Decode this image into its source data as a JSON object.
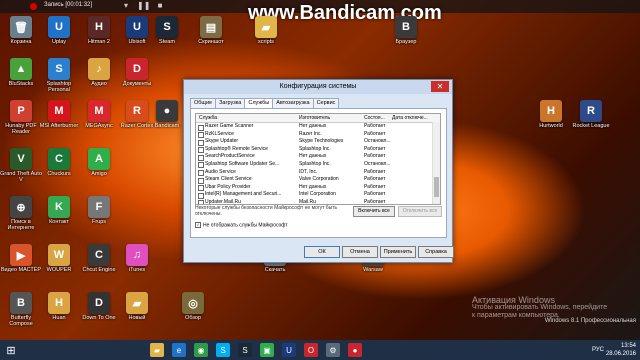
{
  "recorder": {
    "status": "Запись [00:01:32]"
  },
  "watermark": {
    "text": "www.Bandicam.com"
  },
  "desktop_icons": [
    {
      "label": "Корзина",
      "color": "#6a7f8e",
      "glyph": "🗑"
    },
    {
      "label": "Uplay",
      "color": "#1e73c9",
      "glyph": "U"
    },
    {
      "label": "Hitman 2",
      "color": "#5b2828",
      "glyph": "H"
    },
    {
      "label": "Ubisoft",
      "color": "#1a3a7a",
      "glyph": "U"
    },
    {
      "label": "Steam",
      "color": "#1b2838",
      "glyph": "S"
    },
    {
      "label": "Скриншот",
      "color": "#7d6b45",
      "glyph": "▤"
    },
    {
      "label": "scripts",
      "color": "#e0b64b",
      "glyph": "▰"
    },
    {
      "label": "Браузер",
      "color": "#3a3a3a",
      "glyph": "B"
    },
    {
      "label": "BluStacks",
      "color": "#48a23c",
      "glyph": "▲"
    },
    {
      "label": "Splashtop Personal",
      "color": "#2a7fcf",
      "glyph": "S"
    },
    {
      "label": "Аудио",
      "color": "#d9a441",
      "glyph": "♪"
    },
    {
      "label": "Документы",
      "color": "#c9252c",
      "glyph": "D"
    },
    {
      "label": "Hunaby PDF Reader",
      "color": "#d04030",
      "glyph": "P"
    },
    {
      "label": "MSI Afterburner",
      "color": "#d4161c",
      "glyph": "M"
    },
    {
      "label": "MEGAsync",
      "color": "#d9272e",
      "glyph": "M"
    },
    {
      "label": "Razer Cortex",
      "color": "#d84c1c",
      "glyph": "R"
    },
    {
      "label": "Bandicam",
      "color": "#3a3a3a",
      "glyph": "●"
    },
    {
      "label": "Hurtworld",
      "color": "#c9762b",
      "glyph": "H"
    },
    {
      "label": "Rocket League",
      "color": "#2d4b8a",
      "glyph": "R"
    },
    {
      "label": "Grand Theft Auto V",
      "color": "#2a5a2a",
      "glyph": "V"
    },
    {
      "label": "Chuckurs",
      "color": "#1a7a3a",
      "glyph": "C"
    },
    {
      "label": "Amigo",
      "color": "#2fae4a",
      "glyph": "A"
    },
    {
      "label": "Поиск в Интернете",
      "color": "#444",
      "glyph": "⊕"
    },
    {
      "label": "Контакт",
      "color": "#34a853",
      "glyph": "K"
    },
    {
      "label": "Frups",
      "color": "#777",
      "glyph": "F"
    },
    {
      "label": "Видео МАСТЕР",
      "color": "#d9542b",
      "glyph": "▶"
    },
    {
      "label": "WOUPER",
      "color": "#d9a441",
      "glyph": "W"
    },
    {
      "label": "Chcut Engine",
      "color": "#3a3a3a",
      "glyph": "C"
    },
    {
      "label": "iTunes",
      "color": "#e04fbf",
      "glyph": "♫"
    },
    {
      "label": "Butterfly Compose",
      "color": "#555",
      "glyph": "B"
    },
    {
      "label": "Huan",
      "color": "#d9a441",
      "glyph": "H"
    },
    {
      "label": "Down To One",
      "color": "#333",
      "glyph": "D"
    },
    {
      "label": "Новый",
      "color": "#d9a441",
      "glyph": "▰"
    },
    {
      "label": "Warsaw",
      "color": "#5a4a3a",
      "glyph": "W"
    },
    {
      "label": "Скачать",
      "color": "#7a7a7a",
      "glyph": "↓"
    },
    {
      "label": "Обзор",
      "color": "#7a6a3a",
      "glyph": "◎"
    }
  ],
  "dialog": {
    "title": "Конфигурация системы",
    "close_glyph": "✕",
    "tabs": [
      "Общие",
      "Загрузка",
      "Службы",
      "Автозагрузка",
      "Сервис"
    ],
    "active_tab": 2,
    "columns": {
      "service": "Служба",
      "maker": "Изготовитель",
      "state": "Состоя...",
      "date": "Дата отключе..."
    },
    "rows": [
      {
        "service": "Razer Game Scanner",
        "maker": "Нет данных",
        "state": "Работает"
      },
      {
        "service": "RzKLService",
        "maker": "Razer Inc.",
        "state": "Работает"
      },
      {
        "service": "Skype Updater",
        "maker": "Skype Technologies",
        "state": "Остановл..."
      },
      {
        "service": "Splashtop® Remote Service",
        "maker": "Splashtop Inc.",
        "state": "Работает"
      },
      {
        "service": "SearchProductService",
        "maker": "Нет данных",
        "state": "Работает"
      },
      {
        "service": "Splashtop Software Updater Se...",
        "maker": "Splashtop Inc.",
        "state": "Остановл..."
      },
      {
        "service": "Audio Service",
        "maker": "IDT, Inc.",
        "state": "Работает"
      },
      {
        "service": "Steam Client Service",
        "maker": "Valve Corporation",
        "state": "Работает"
      },
      {
        "service": "Ubar Policy Provider",
        "maker": "Нет данных",
        "state": "Работает"
      },
      {
        "service": "Intel(R) Management and Securi...",
        "maker": "Intel Corporation",
        "state": "Работает"
      },
      {
        "service": "Updater.Mail.Ru",
        "maker": "Mail.Ru",
        "state": "Работает"
      }
    ],
    "note": "Некоторые службы безопасности Майкрософт не могут быть отключены.",
    "enable_all": "Включить все",
    "disable_all": "Отключить все",
    "hide_ms": "Не отображать службы Майкрософт",
    "hide_ms_checked": "✓",
    "buttons": {
      "ok": "ОК",
      "cancel": "Отмена",
      "apply": "Применить",
      "help": "Справка"
    }
  },
  "activation": {
    "line1": "Активация Windows",
    "line2": "Чтобы активировать Windows, перейдите",
    "line3": "к параметрам компьютера."
  },
  "edition": "Windows 8.1 Профессиональная",
  "taskbar": {
    "lang": "РУС",
    "time": "13:54",
    "date": "28.06.2016",
    "apps": [
      {
        "name": "explorer",
        "color": "#e0b64b",
        "glyph": "▰"
      },
      {
        "name": "ie",
        "color": "#1e73c9",
        "glyph": "e"
      },
      {
        "name": "chrome",
        "color": "#2f9a48",
        "glyph": "◉"
      },
      {
        "name": "skype",
        "color": "#00aff0",
        "glyph": "S"
      },
      {
        "name": "steam",
        "color": "#1b2838",
        "glyph": "S"
      },
      {
        "name": "store",
        "color": "#2fae4a",
        "glyph": "▣"
      },
      {
        "name": "ubisoft",
        "color": "#1a3a7a",
        "glyph": "U"
      },
      {
        "name": "opera",
        "color": "#c9252c",
        "glyph": "O"
      },
      {
        "name": "msconfig",
        "color": "#5a6a7a",
        "glyph": "⚙"
      },
      {
        "name": "bandicam",
        "color": "#c9252c",
        "glyph": "●"
      }
    ]
  }
}
